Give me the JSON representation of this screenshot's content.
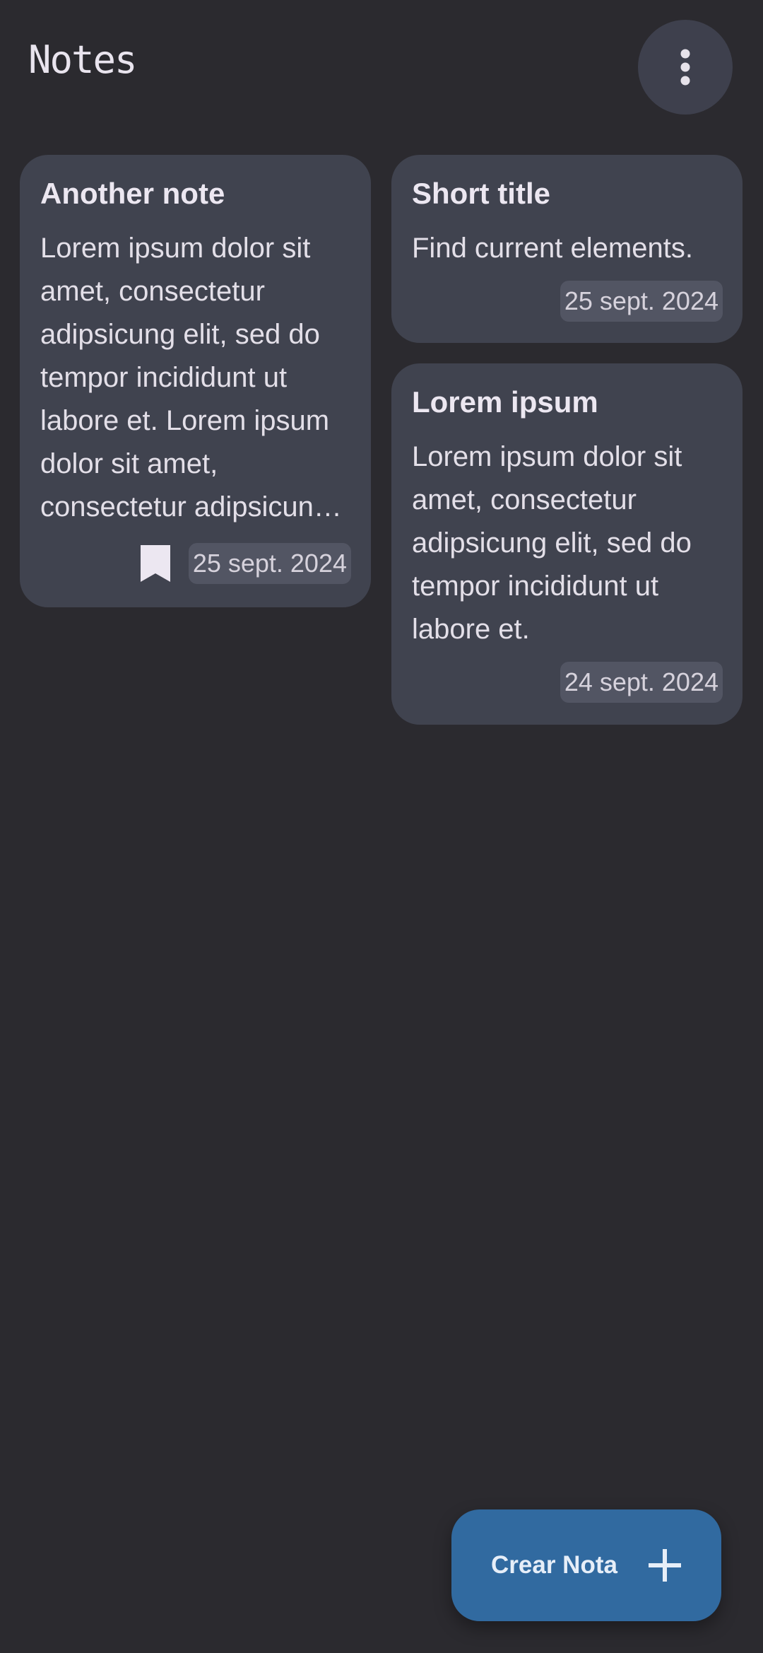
{
  "header": {
    "title": "Notes",
    "menu_icon": "more-vert-icon"
  },
  "notes": [
    {
      "title": "Another note",
      "body": "Lorem ipsum dolor sit amet, consectetur adipsicung elit, sed do tempor incididunt ut labore et. Lorem ipsum dolor sit amet, consectetur adipsicung elit, sed do tempor incididunt ut labore et.",
      "date": "25 sept. 2024",
      "bookmarked": true
    },
    {
      "title": "Short title",
      "body": "Find current elements.",
      "date": "25 sept. 2024",
      "bookmarked": false
    },
    {
      "title": "Lorem ipsum",
      "body": "Lorem ipsum dolor sit amet, consectetur adipsicung elit, sed do tempor incididunt ut labore et.",
      "date": "24 sept. 2024",
      "bookmarked": false
    }
  ],
  "fab": {
    "label": "Crear Nota",
    "icon": "plus-icon"
  },
  "colors": {
    "background": "#2b2a2f",
    "card": "#40434f",
    "accent": "#316aa0"
  }
}
